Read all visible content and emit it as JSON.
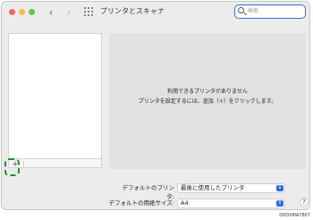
{
  "window": {
    "title": "プリンタとスキャナ",
    "nav_back": "‹",
    "nav_forward": "›"
  },
  "search": {
    "placeholder": "検索"
  },
  "printer_list": {
    "add_label": "+"
  },
  "empty_state": {
    "line1": "利用できるプリンタがありません",
    "line2": "プリンタを設定するには、追加（+）をクリックします。"
  },
  "settings": {
    "default_printer_label": "デフォルトのプリンタ:",
    "default_printer_value": "最後に使用したプリンタ",
    "default_paper_label": "デフォルトの用紙サイズ:",
    "default_paper_value": "A4"
  },
  "help": "?",
  "figure_code": "D0DXMA7807",
  "colors": {
    "accent": "#2f6fd8",
    "highlight": "#2b8a2b"
  }
}
